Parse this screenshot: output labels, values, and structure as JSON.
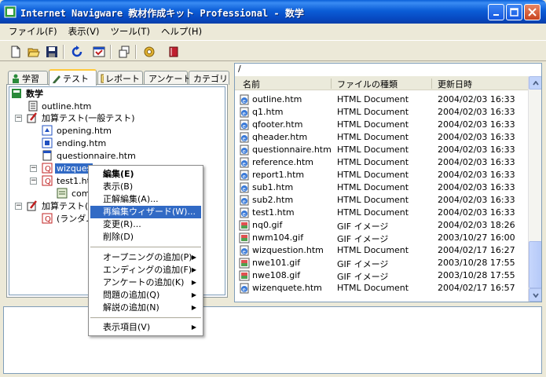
{
  "window": {
    "title": "Internet Navigware 教材作成キット Professional - 数学"
  },
  "menu": [
    "ファイル(F)",
    "表示(V)",
    "ツール(T)",
    "ヘルプ(H)"
  ],
  "toolbar": [
    "new-icon",
    "open-folder-icon",
    "save-icon",
    "refresh-icon",
    "properties-icon",
    "window-icon",
    "gear-icon",
    "book-icon"
  ],
  "tabs": [
    {
      "label": "学習"
    },
    {
      "label": "テスト"
    },
    {
      "label": "レポート"
    },
    {
      "label": "アンケート"
    },
    {
      "label": "カテゴリ"
    }
  ],
  "tree": {
    "root": "数学",
    "items": [
      "outline.htm",
      "加算テスト(一般テスト)",
      "opening.htm",
      "ending.htm",
      "questionnaire.htm",
      "wizques",
      "test1.ht",
      "com",
      "加算テスト(",
      "(ランダム"
    ]
  },
  "filelist": {
    "path": "/",
    "columns": [
      "名前",
      "ファイルの種類",
      "更新日時"
    ],
    "rows": [
      {
        "name": "outline.htm",
        "type": "HTML Document",
        "date": "2004/02/03 16:33"
      },
      {
        "name": "q1.htm",
        "type": "HTML Document",
        "date": "2004/02/03 16:33"
      },
      {
        "name": "qfooter.htm",
        "type": "HTML Document",
        "date": "2004/02/03 16:33"
      },
      {
        "name": "qheader.htm",
        "type": "HTML Document",
        "date": "2004/02/03 16:33"
      },
      {
        "name": "questionnaire.htm",
        "type": "HTML Document",
        "date": "2004/02/03 16:33"
      },
      {
        "name": "reference.htm",
        "type": "HTML Document",
        "date": "2004/02/03 16:33"
      },
      {
        "name": "report1.htm",
        "type": "HTML Document",
        "date": "2004/02/03 16:33"
      },
      {
        "name": "sub1.htm",
        "type": "HTML Document",
        "date": "2004/02/03 16:33"
      },
      {
        "name": "sub2.htm",
        "type": "HTML Document",
        "date": "2004/02/03 16:33"
      },
      {
        "name": "test1.htm",
        "type": "HTML Document",
        "date": "2004/02/03 16:33"
      },
      {
        "name": "nq0.gif",
        "type": "GIF イメージ",
        "date": "2004/02/03 18:26"
      },
      {
        "name": "nwm104.gif",
        "type": "GIF イメージ",
        "date": "2003/10/27 16:00"
      },
      {
        "name": "wizquestion.htm",
        "type": "HTML Document",
        "date": "2004/02/17 16:27"
      },
      {
        "name": "nwe101.gif",
        "type": "GIF イメージ",
        "date": "2003/10/28 17:55"
      },
      {
        "name": "nwe108.gif",
        "type": "GIF イメージ",
        "date": "2003/10/28 17:55"
      },
      {
        "name": "wizenquete.htm",
        "type": "HTML Document",
        "date": "2004/02/17 16:57"
      }
    ]
  },
  "context_menu": [
    {
      "label": "編集(E)",
      "bold": true
    },
    {
      "label": "表示(B)"
    },
    {
      "label": "正解編集(A)..."
    },
    {
      "label": "再編集ウィザード(W)...",
      "highlighted": true
    },
    {
      "label": "変更(R)..."
    },
    {
      "label": "削除(D)"
    },
    {
      "label": "オープニングの追加(P)",
      "submenu": true
    },
    {
      "label": "エンディングの追加(F)",
      "submenu": true
    },
    {
      "label": "アンケートの追加(K)",
      "submenu": true
    },
    {
      "label": "問題の追加(Q)",
      "submenu": true
    },
    {
      "label": "解説の追加(N)",
      "submenu": true
    },
    {
      "label": "表示項目(V)",
      "submenu": true
    }
  ],
  "colors": {
    "titlebar": "#0b5dd7",
    "selection": "#316ac5",
    "face": "#ece9d8"
  }
}
